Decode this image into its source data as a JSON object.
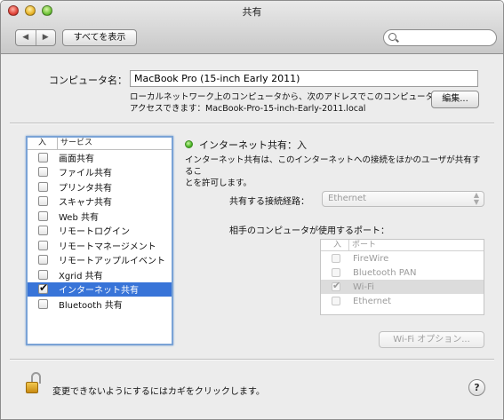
{
  "window": {
    "title": "共有"
  },
  "toolbar": {
    "back_icon": "back-arrow-icon",
    "forward_icon": "forward-arrow-icon",
    "back_glyph": "◀",
    "forward_glyph": "▶",
    "show_all_label": "すべてを表示",
    "search_placeholder": ""
  },
  "computer": {
    "name_label": "コンピュータ名：",
    "name_value": "MacBook Pro (15-inch Early 2011)",
    "address_line1": "ローカルネットワーク上のコンピュータから、次のアドレスでこのコンピュータに",
    "address_line2": "アクセスできます：MacBook-Pro-15-inch-Early-2011.local",
    "edit_label": "編集..."
  },
  "services": {
    "col_on": "入",
    "col_service": "サービス",
    "items": [
      {
        "label": "画面共有",
        "checked": false,
        "selected": false
      },
      {
        "label": "ファイル共有",
        "checked": false,
        "selected": false
      },
      {
        "label": "プリンタ共有",
        "checked": false,
        "selected": false
      },
      {
        "label": "スキャナ共有",
        "checked": false,
        "selected": false
      },
      {
        "label": "Web 共有",
        "checked": false,
        "selected": false
      },
      {
        "label": "リモートログイン",
        "checked": false,
        "selected": false
      },
      {
        "label": "リモートマネージメント",
        "checked": false,
        "selected": false
      },
      {
        "label": "リモートアップルイベント",
        "checked": false,
        "selected": false
      },
      {
        "label": "Xgrid 共有",
        "checked": false,
        "selected": false
      },
      {
        "label": "インターネット共有",
        "checked": true,
        "selected": true
      },
      {
        "label": "Bluetooth 共有",
        "checked": false,
        "selected": false
      }
    ]
  },
  "detail": {
    "status_title": "インターネット共有：入",
    "status_color": "#4cb627",
    "description_line1": "インターネット共有は、このインターネットへの接続をほかのユーザが共有するこ",
    "description_line2": "とを許可します。",
    "share_from_label": "共有する接続経路：",
    "share_from_value": "Ethernet",
    "ports_label": "相手のコンピュータが使用するポート：",
    "ports_col_on": "入",
    "ports_col_port": "ポート",
    "ports": [
      {
        "label": "FireWire",
        "checked": false,
        "selected": false
      },
      {
        "label": "Bluetooth PAN",
        "checked": false,
        "selected": false
      },
      {
        "label": "Wi-Fi",
        "checked": true,
        "selected": true
      },
      {
        "label": "Ethernet",
        "checked": false,
        "selected": false
      }
    ],
    "wifi_options_label": "Wi-Fi オプション..."
  },
  "footer": {
    "lock_text": "変更できないようにするにはカギをクリックします。",
    "help_label": "?"
  }
}
